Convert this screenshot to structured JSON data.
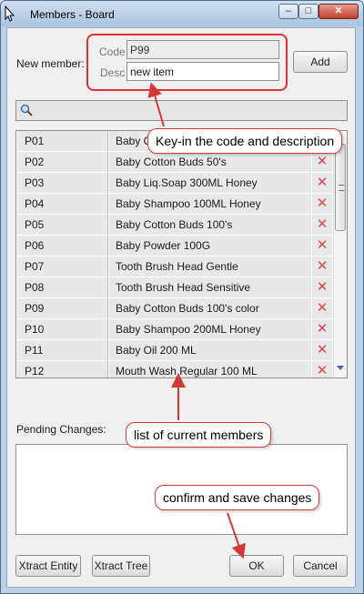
{
  "window": {
    "title": "Members - Board",
    "min_glyph": "–",
    "max_glyph": "□",
    "close_glyph": "✕"
  },
  "new_member": {
    "label": "New member:",
    "code_label": "Code",
    "code_value": "P99",
    "desc_label": "Desc",
    "desc_value": "new item",
    "add_label": "Add"
  },
  "members": {
    "rows": [
      {
        "code": "P01",
        "desc": "Baby Cotton Buds"
      },
      {
        "code": "P02",
        "desc": "Baby Cotton Buds  50's"
      },
      {
        "code": "P03",
        "desc": "Baby Liq.Soap 300ML Honey"
      },
      {
        "code": "P04",
        "desc": "Baby Shampoo 100ML Honey"
      },
      {
        "code": "P05",
        "desc": "Baby Cotton Buds 100's"
      },
      {
        "code": "P06",
        "desc": "Baby Powder 100G"
      },
      {
        "code": "P07",
        "desc": "Tooth Brush Head Gentle"
      },
      {
        "code": "P08",
        "desc": "Tooth Brush Head Sensitive"
      },
      {
        "code": "P09",
        "desc": "Baby Cotton Buds 100's color"
      },
      {
        "code": "P10",
        "desc": "Baby Shampoo 200ML Honey"
      },
      {
        "code": "P11",
        "desc": "Baby Oil  200 ML"
      },
      {
        "code": "P12",
        "desc": "Mouth Wash Regular 100 ML"
      }
    ],
    "delete_glyph": "✕"
  },
  "pending": {
    "label": "Pending Changes:"
  },
  "buttons": {
    "xtract_entity": "Xtract Entity",
    "xtract_tree": "Xtract Tree",
    "ok": "OK",
    "cancel": "Cancel"
  },
  "callouts": {
    "keyin": "Key-in the code and description",
    "list": "list of current members",
    "confirm": "confirm and save changes"
  },
  "colors": {
    "callout_border": "#d23a3a",
    "delete_icon": "#d94a4a"
  }
}
